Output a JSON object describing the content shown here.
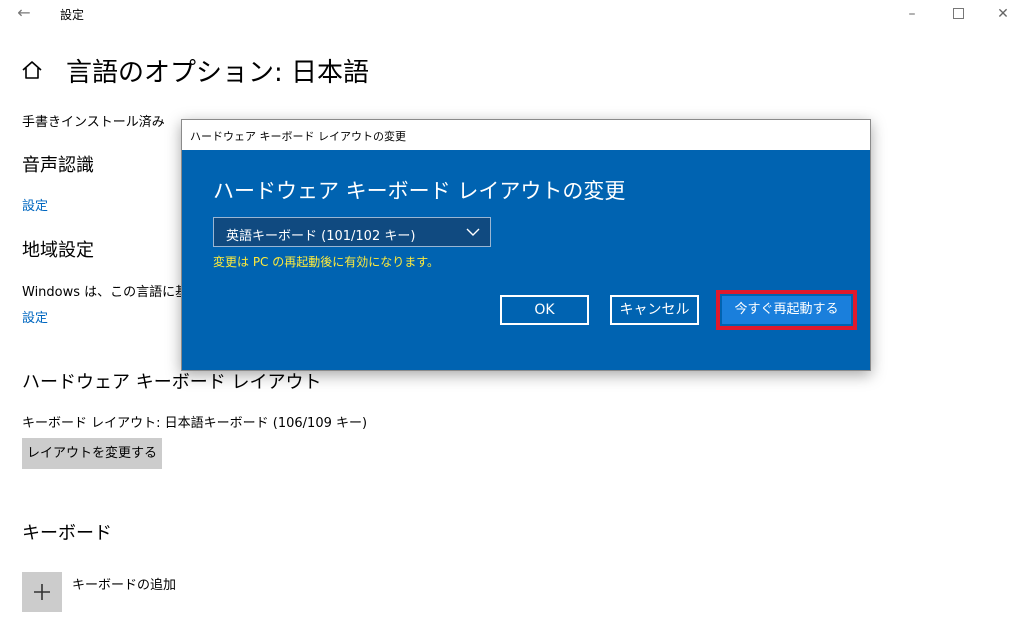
{
  "window": {
    "back_icon": "back-arrow-icon",
    "title": "設定",
    "minimize_icon": "minimize-icon",
    "maximize_icon": "maximize-icon",
    "close_icon": "close-icon"
  },
  "page": {
    "home_icon": "home-icon",
    "title": "言語のオプション: 日本語",
    "handwriting_status": "手書きインストール済み",
    "speech": {
      "heading": "音声認識",
      "settings_link": "設定"
    },
    "region": {
      "heading": "地域設定",
      "description": "Windows は、この言語に基づ",
      "settings_link": "設定"
    },
    "hardware_keyboard": {
      "heading": "ハードウェア キーボード レイアウト",
      "current_layout": "キーボード レイアウト:   日本語キーボード (106/109 キー)",
      "change_button": "レイアウトを変更する"
    },
    "keyboard": {
      "heading": "キーボード",
      "add_icon": "plus-icon",
      "add_label": "キーボードの追加"
    }
  },
  "dialog": {
    "title": "ハードウェア キーボード レイアウトの変更",
    "heading": "ハードウェア キーボード レイアウトの変更",
    "dropdown": {
      "selected": "英語キーボード (101/102 キー)",
      "icon": "chevron-down-icon"
    },
    "note": "変更は PC の再起動後に有効になります。",
    "buttons": {
      "ok": "OK",
      "cancel": "キャンセル",
      "restart": "今すぐ再起動する"
    },
    "colors": {
      "background": "#0063b1",
      "highlight": "#e0192c",
      "note": "#ffeb3b"
    }
  }
}
